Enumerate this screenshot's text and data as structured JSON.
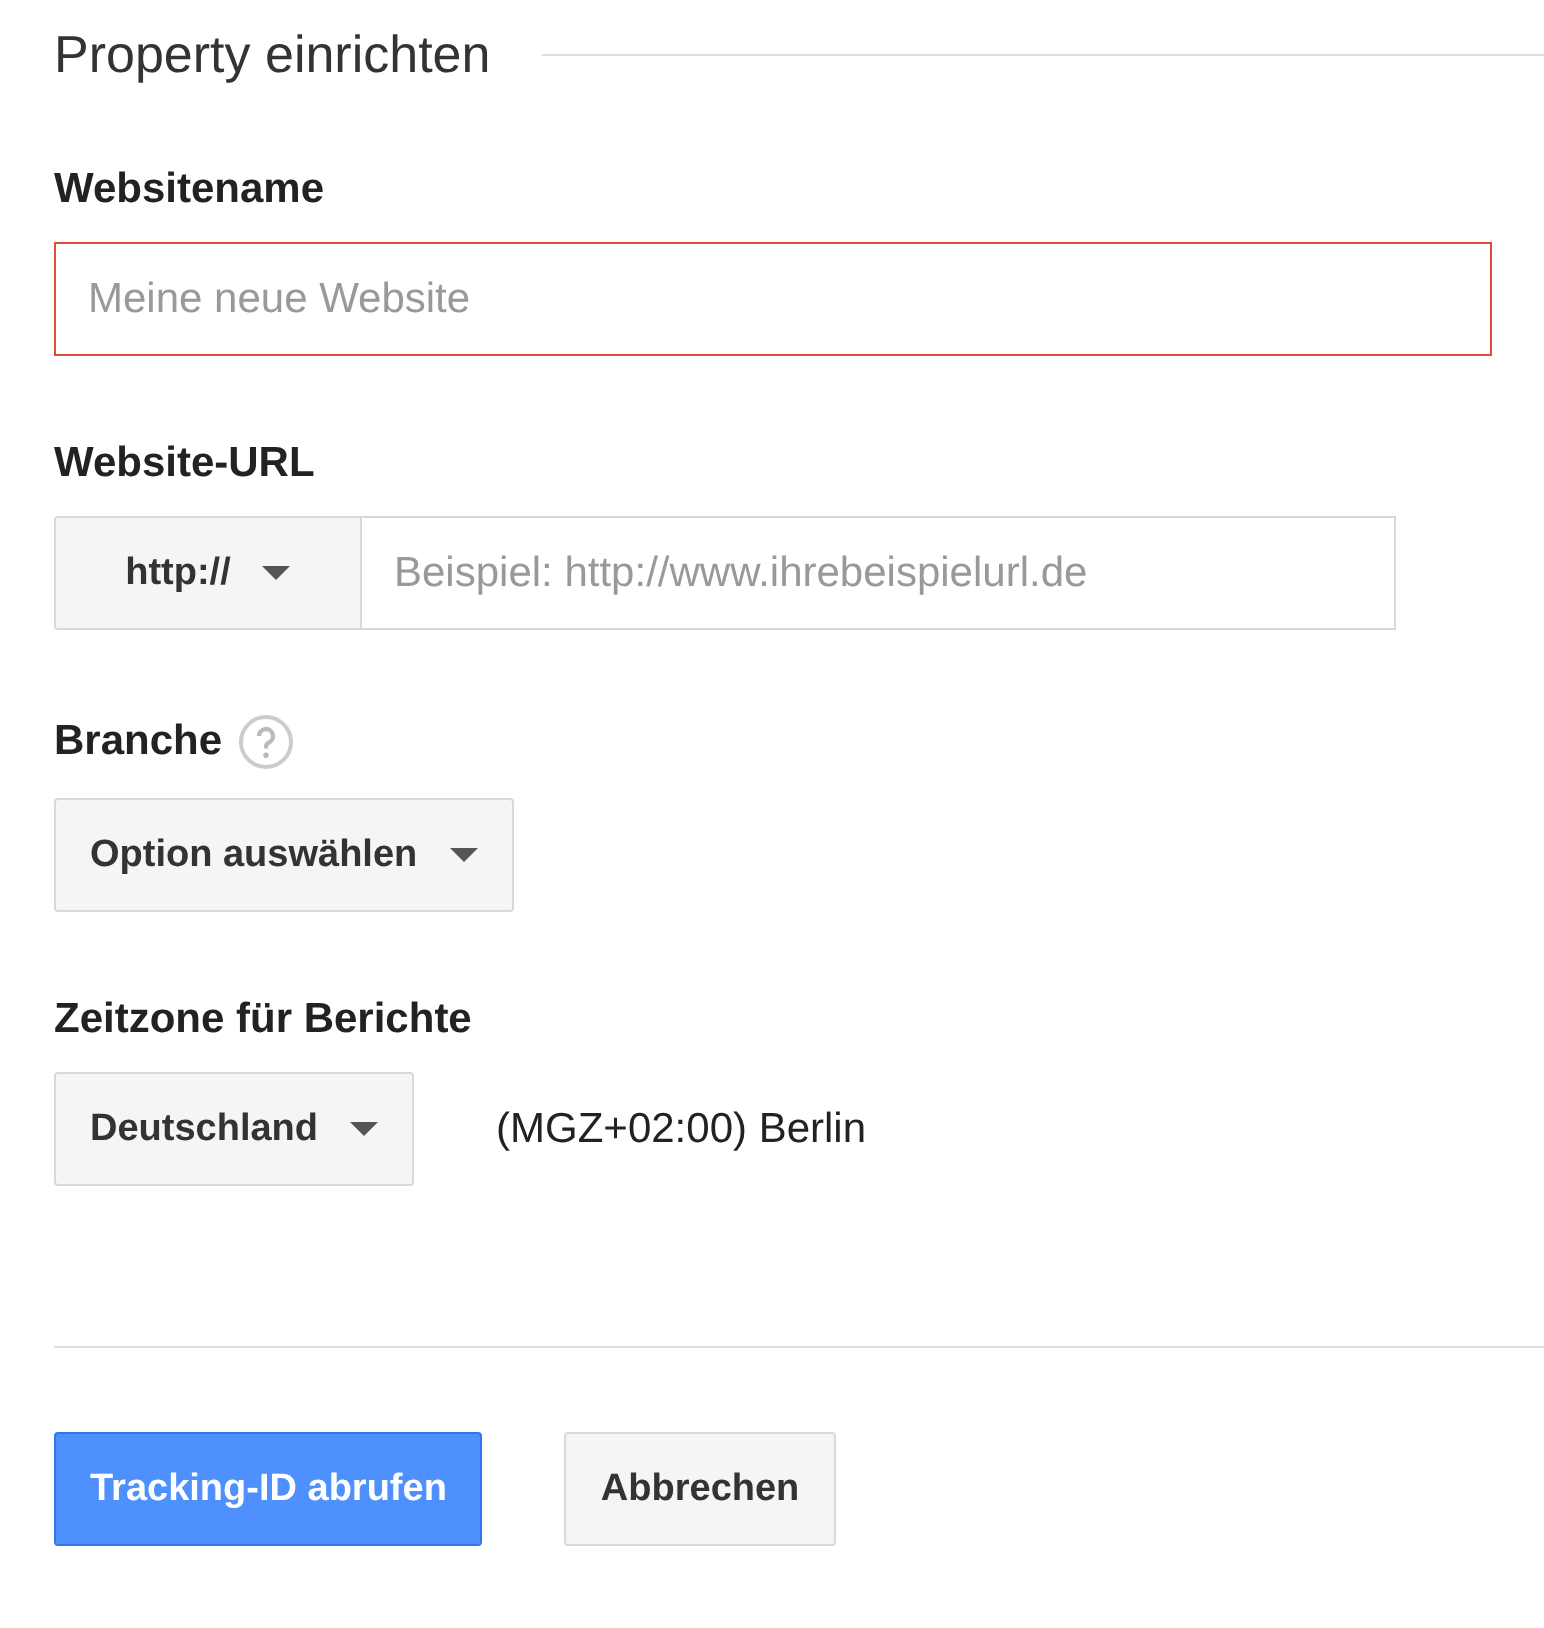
{
  "title": "Property einrichten",
  "fields": [
    {
      "kind": "text",
      "label": "Websitename",
      "placeholder": "Meine neue Website",
      "invalid": true
    },
    {
      "kind": "url",
      "label": "Website-URL",
      "protocol": "http://",
      "placeholder": "Beispiel: http://www.ihrebeispielurl.de"
    },
    {
      "kind": "select",
      "label": "Branche",
      "help": true,
      "value": "Option auswählen"
    },
    {
      "kind": "select",
      "label": "Zeitzone für Berichte",
      "help": false,
      "value": "Deutschland",
      "note": "(MGZ+02:00) Berlin"
    }
  ],
  "buttons": [
    {
      "kind": "primary",
      "label": "Tracking-ID abrufen"
    },
    {
      "kind": "secondary",
      "label": "Abbrechen"
    }
  ]
}
